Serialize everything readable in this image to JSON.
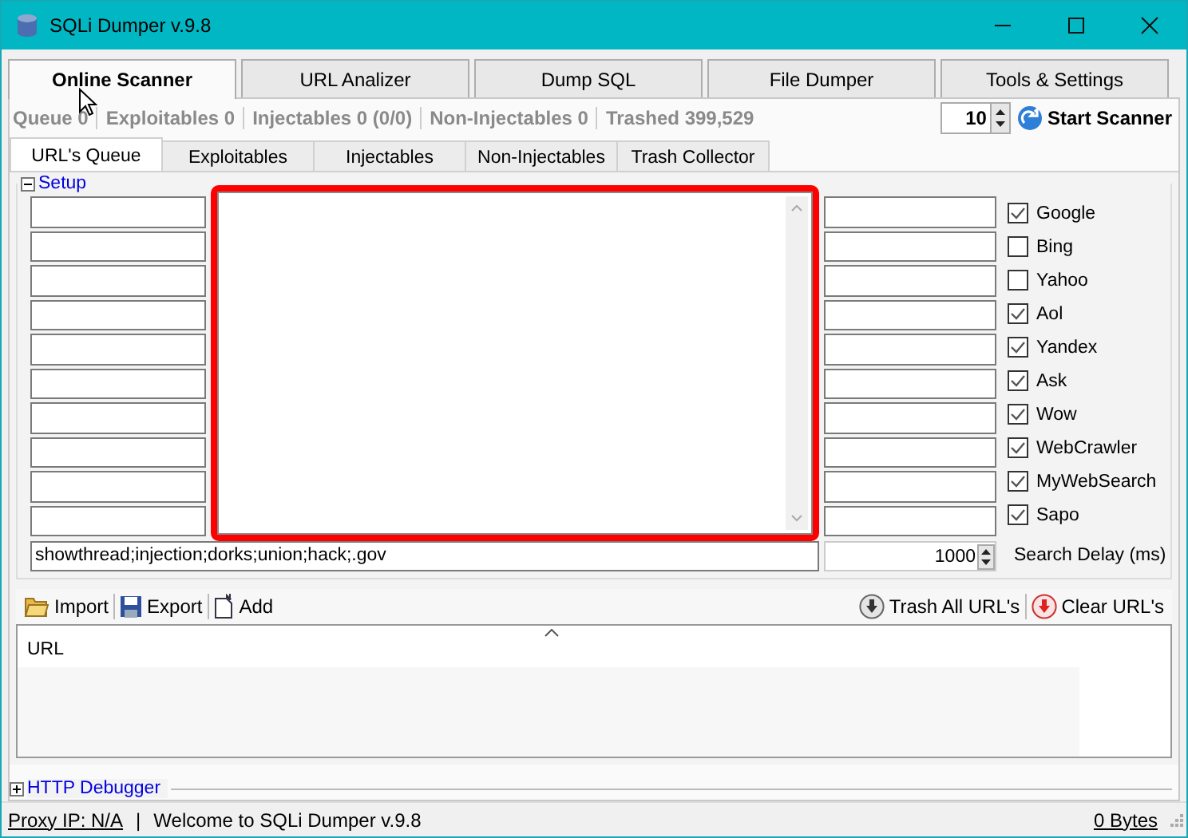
{
  "window": {
    "title": "SQLi Dumper v.9.8"
  },
  "tabs": [
    {
      "label": "Online Scanner",
      "selected": true
    },
    {
      "label": "URL Analizer",
      "selected": false
    },
    {
      "label": "Dump SQL",
      "selected": false
    },
    {
      "label": "File Dumper",
      "selected": false
    },
    {
      "label": "Tools & Settings",
      "selected": false
    }
  ],
  "stats": [
    "Queue 0",
    "Exploitables 0",
    "Injectables 0 (0/0)",
    "Non-Injectables 0",
    "Trashed 399,529"
  ],
  "threads": {
    "value": "10"
  },
  "start_button": {
    "label": "Start Scanner"
  },
  "subtabs": [
    {
      "label": "URL's Queue",
      "selected": true
    },
    {
      "label": "Exploitables",
      "selected": false
    },
    {
      "label": "Injectables",
      "selected": false
    },
    {
      "label": "Non-Injectables",
      "selected": false
    },
    {
      "label": "Trash Collector",
      "selected": false
    }
  ],
  "setup": {
    "label": "Setup",
    "expanded": true
  },
  "engines": [
    {
      "label": "Google",
      "checked": true
    },
    {
      "label": "Bing",
      "checked": false
    },
    {
      "label": "Yahoo",
      "checked": false
    },
    {
      "label": "Aol",
      "checked": true
    },
    {
      "label": "Yandex",
      "checked": true
    },
    {
      "label": "Ask",
      "checked": true
    },
    {
      "label": "Wow",
      "checked": true
    },
    {
      "label": "WebCrawler",
      "checked": true
    },
    {
      "label": "MyWebSearch",
      "checked": true
    },
    {
      "label": "Sapo",
      "checked": true
    }
  ],
  "exclude_field": {
    "value": "showthread;injection;dorks;union;hack;.gov"
  },
  "search_delay": {
    "value": "1000",
    "label": "Search Delay (ms)"
  },
  "toolbar_left": [
    {
      "label": "Import",
      "kind": "folder"
    },
    {
      "label": "Export",
      "kind": "save"
    },
    {
      "label": "Add",
      "kind": "page"
    }
  ],
  "toolbar_right": [
    {
      "label": "Trash All URL's",
      "kind": "trash"
    },
    {
      "label": "Clear URL's",
      "kind": "clear"
    }
  ],
  "url_list": {
    "columns": [
      "URL"
    ]
  },
  "http_debugger": {
    "label": "HTTP Debugger",
    "expanded": false
  },
  "status_bar": {
    "proxy": "Proxy IP: N/A",
    "separator": "|",
    "message": "Welcome to SQLi Dumper v.9.8",
    "bytes": "0 Bytes"
  }
}
